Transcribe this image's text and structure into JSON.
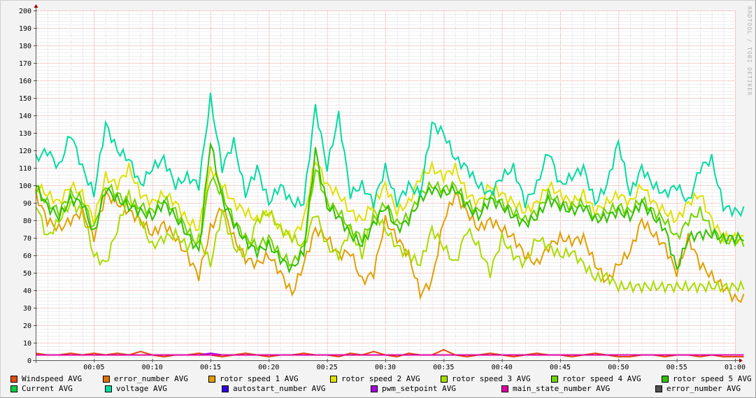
{
  "watermark": "RRDTOOL / TOBI OETIKER",
  "chart_data": {
    "type": "line",
    "title": "",
    "xlabel": "",
    "ylabel": "",
    "ylim": [
      0,
      200
    ],
    "yticks": [
      0,
      10,
      20,
      30,
      40,
      50,
      60,
      70,
      80,
      90,
      100,
      110,
      120,
      130,
      140,
      150,
      160,
      170,
      180,
      190,
      200
    ],
    "xlim_minutes": [
      0,
      60
    ],
    "xticks": [
      {
        "m": 5,
        "label": "00:05"
      },
      {
        "m": 10,
        "label": "00:10"
      },
      {
        "m": 15,
        "label": "00:15"
      },
      {
        "m": 20,
        "label": "00:20"
      },
      {
        "m": 25,
        "label": "00:25"
      },
      {
        "m": 30,
        "label": "00:30"
      },
      {
        "m": 35,
        "label": "00:35"
      },
      {
        "m": 40,
        "label": "00:40"
      },
      {
        "m": 45,
        "label": "00:45"
      },
      {
        "m": 50,
        "label": "00:50"
      },
      {
        "m": 55,
        "label": "00:55"
      },
      {
        "m": 60,
        "label": "01:00"
      }
    ],
    "grid": true,
    "legend_position": "bottom",
    "x_minutes_step": 1,
    "series": [
      {
        "name": "Windspeed AVG",
        "color": "#e64a0a",
        "values": [
          4,
          3,
          3,
          4,
          3,
          4,
          3,
          4,
          3,
          5,
          3,
          2,
          3,
          3,
          4,
          3,
          2,
          3,
          4,
          3,
          2,
          3,
          3,
          4,
          3,
          3,
          2,
          4,
          3,
          5,
          3,
          2,
          4,
          3,
          3,
          6,
          3,
          2,
          3,
          4,
          3,
          2,
          3,
          4,
          3,
          3,
          2,
          3,
          4,
          3,
          2,
          2,
          3,
          3,
          2,
          3,
          3,
          2,
          3,
          2,
          2
        ]
      },
      {
        "name": "error_number AVG",
        "color": "#e07000",
        "values": null
      },
      {
        "name": "rotor speed 1 AVG",
        "color": "#e0a000",
        "values": [
          95,
          80,
          75,
          80,
          85,
          70,
          95,
          90,
          85,
          80,
          72,
          78,
          70,
          60,
          48,
          75,
          88,
          70,
          58,
          55,
          60,
          50,
          38,
          55,
          75,
          70,
          60,
          62,
          45,
          50,
          80,
          70,
          60,
          38,
          45,
          80,
          95,
          85,
          75,
          80,
          75,
          70,
          60,
          55,
          65,
          70,
          68,
          70,
          55,
          45,
          55,
          62,
          80,
          72,
          65,
          50,
          70,
          55,
          48,
          42,
          35
        ]
      },
      {
        "name": "rotor speed 2 AVG",
        "color": "#e0e000",
        "values": [
          100,
          95,
          90,
          100,
          95,
          80,
          105,
          100,
          110,
          95,
          90,
          95,
          90,
          80,
          75,
          110,
          100,
          90,
          85,
          80,
          85,
          75,
          70,
          80,
          115,
          100,
          95,
          85,
          80,
          90,
          100,
          85,
          90,
          105,
          110,
          105,
          110,
          95,
          90,
          100,
          95,
          90,
          85,
          90,
          100,
          95,
          90,
          95,
          85,
          90,
          95,
          90,
          100,
          90,
          85,
          80,
          90,
          95,
          80,
          70,
          70
        ]
      },
      {
        "name": "rotor speed 3 AVG",
        "color": "#a8dc00",
        "values": [
          90,
          70,
          80,
          90,
          85,
          60,
          55,
          75,
          95,
          80,
          65,
          70,
          72,
          65,
          70,
          55,
          85,
          65,
          60,
          80,
          85,
          75,
          70,
          65,
          85,
          65,
          60,
          75,
          60,
          85,
          75,
          65,
          60,
          55,
          75,
          65,
          55,
          75,
          65,
          50,
          70,
          60,
          55,
          70,
          65,
          60,
          62,
          55,
          47,
          48,
          42,
          42,
          42,
          42,
          42,
          42,
          42,
          42,
          42,
          42,
          42
        ]
      },
      {
        "name": "rotor speed 4 AVG",
        "color": "#70d400",
        "values": [
          98,
          90,
          85,
          95,
          92,
          75,
          100,
          95,
          90,
          88,
          85,
          92,
          85,
          75,
          65,
          105,
          95,
          80,
          70,
          65,
          70,
          60,
          55,
          65,
          110,
          90,
          85,
          75,
          70,
          80,
          90,
          78,
          82,
          95,
          100,
          98,
          100,
          90,
          85,
          95,
          90,
          85,
          80,
          85,
          95,
          90,
          88,
          90,
          82,
          85,
          88,
          85,
          92,
          85,
          80,
          70,
          80,
          85,
          75,
          68,
          68
        ]
      },
      {
        "name": "rotor speed 5 AVG",
        "color": "#30c000",
        "values": [
          100,
          88,
          82,
          92,
          90,
          72,
          98,
          92,
          88,
          85,
          82,
          90,
          82,
          72,
          62,
          125,
          92,
          78,
          68,
          62,
          66,
          58,
          52,
          62,
          120,
          88,
          82,
          72,
          66,
          78,
          88,
          75,
          80,
          92,
          98,
          95,
          98,
          88,
          82,
          92,
          88,
          82,
          78,
          82,
          92,
          88,
          85,
          88,
          80,
          82,
          85,
          82,
          90,
          82,
          75,
          52,
          70,
          72,
          72,
          70,
          70
        ]
      },
      {
        "name": "Current AVG",
        "color": "#00d040",
        "values": null
      },
      {
        "name": "voltage AVG",
        "color": "#00dca0",
        "values": [
          115,
          120,
          110,
          130,
          110,
          95,
          135,
          120,
          115,
          100,
          110,
          115,
          100,
          105,
          100,
          150,
          110,
          125,
          95,
          110,
          90,
          100,
          90,
          90,
          145,
          110,
          140,
          95,
          100,
          90,
          110,
          90,
          100,
          95,
          135,
          130,
          115,
          110,
          100,
          95,
          105,
          110,
          90,
          100,
          120,
          100,
          105,
          110,
          90,
          100,
          125,
          95,
          110,
          100,
          95,
          100,
          90,
          110,
          115,
          88,
          85
        ]
      },
      {
        "name": "autostart_number AVG",
        "color": "#3000e0",
        "values": null
      },
      {
        "name": "pwm_setpoint AVG",
        "color": "#a800e0",
        "values": [
          3,
          3,
          3,
          3,
          3,
          3,
          3,
          3,
          3,
          3,
          3,
          3,
          3,
          3,
          3,
          4,
          3,
          3,
          3,
          3,
          3,
          3,
          3,
          3,
          3,
          3,
          3,
          3,
          3,
          3,
          3,
          3,
          3,
          3,
          3,
          3,
          3,
          3,
          3,
          3,
          3,
          3,
          3,
          3,
          3,
          3,
          3,
          3,
          3,
          3,
          3,
          3,
          3,
          3,
          3,
          3,
          3,
          3,
          3,
          3,
          3
        ]
      },
      {
        "name": "main_state_number AVG",
        "color": "#e000a0",
        "values": [
          3,
          3,
          3,
          3,
          3,
          3,
          3,
          3,
          3,
          3,
          3,
          3,
          3,
          3,
          3,
          3,
          3,
          3,
          3,
          3,
          3,
          3,
          3,
          3,
          3,
          3,
          3,
          3,
          3,
          3,
          3,
          3,
          3,
          3,
          3,
          3,
          3,
          3,
          3,
          3,
          3,
          3,
          3,
          3,
          3,
          3,
          3,
          3,
          3,
          3,
          3,
          3,
          3,
          3,
          3,
          3,
          3,
          3,
          3,
          3,
          3
        ]
      },
      {
        "name": "error_number AVG",
        "color": "#505050",
        "values": null
      }
    ]
  }
}
